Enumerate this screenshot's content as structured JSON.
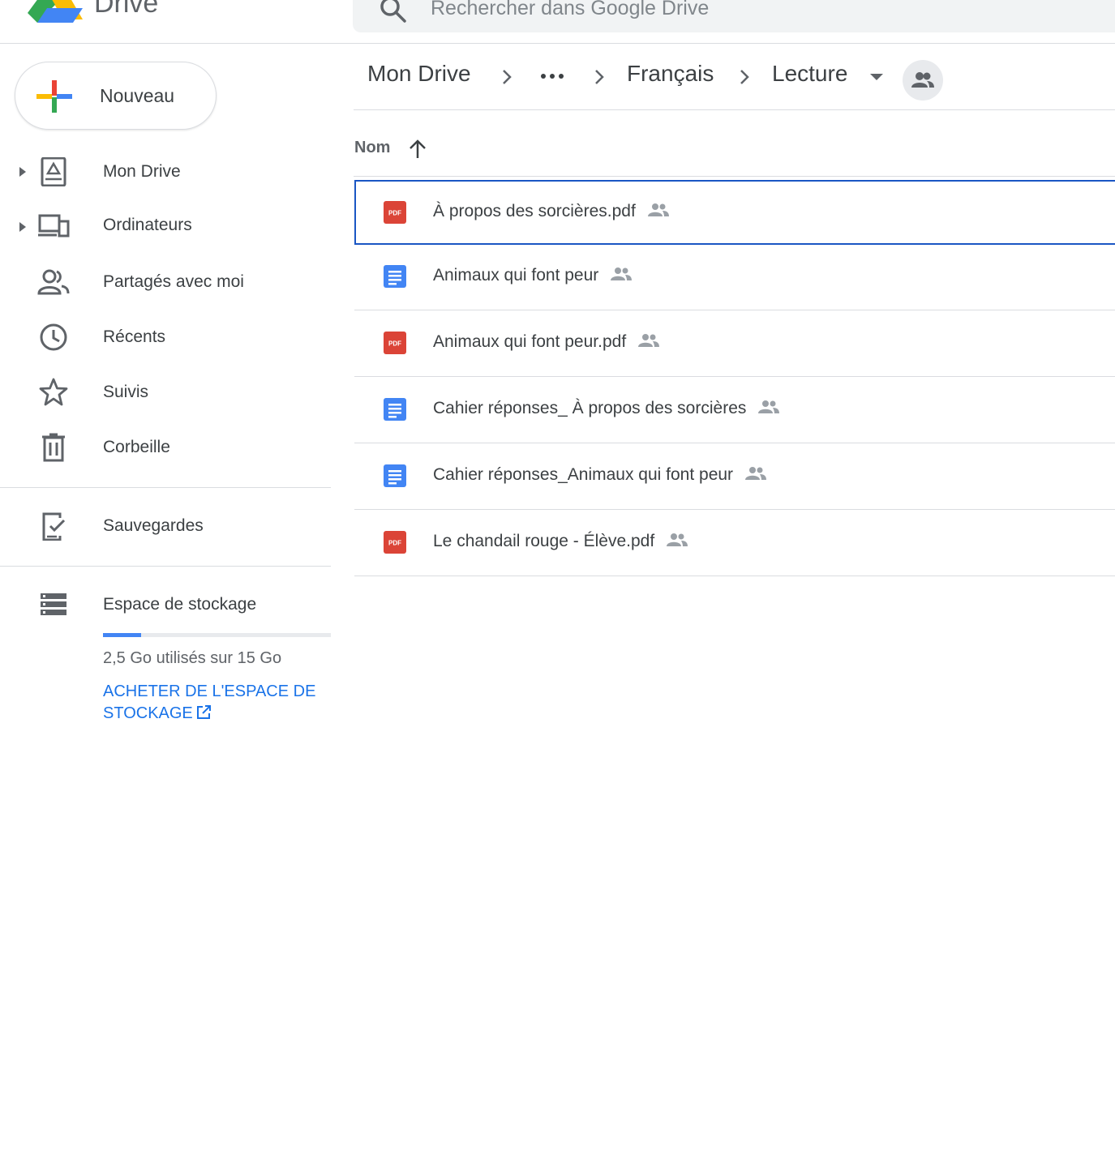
{
  "header": {
    "app_name": "Drive",
    "search_placeholder": "Rechercher dans Google Drive"
  },
  "sidebar": {
    "new_label": "Nouveau",
    "items": [
      {
        "label": "Mon Drive",
        "icon": "my-drive-icon"
      },
      {
        "label": "Ordinateurs",
        "icon": "computers-icon"
      },
      {
        "label": "Partagés avec moi",
        "icon": "people-icon"
      },
      {
        "label": "Récents",
        "icon": "clock-icon"
      },
      {
        "label": "Suivis",
        "icon": "star-icon"
      },
      {
        "label": "Corbeille",
        "icon": "trash-icon"
      },
      {
        "label": "Sauvegardes",
        "icon": "backup-icon"
      },
      {
        "label": "Espace de stockage",
        "icon": "storage-icon"
      }
    ],
    "storage": {
      "used_fraction": 0.1667,
      "text": "2,5 Go utilisés sur 15 Go",
      "buy_label": "ACHETER DE L'ESPACE DE STOCKAGE"
    }
  },
  "breadcrumb": {
    "items": [
      "Mon Drive",
      "Français",
      "Lecture"
    ],
    "more": "more-horiz-icon"
  },
  "list": {
    "column_name": "Nom",
    "sort": "ascending",
    "files": [
      {
        "name": "À propos des sorcières.pdf",
        "type": "pdf",
        "shared": true,
        "selected": true
      },
      {
        "name": "Animaux qui font peur",
        "type": "doc",
        "shared": true
      },
      {
        "name": "Animaux qui font peur.pdf",
        "type": "pdf",
        "shared": true
      },
      {
        "name": "Cahier réponses_ À propos des sorcières",
        "type": "doc",
        "shared": true
      },
      {
        "name": "Cahier réponses_Animaux qui font peur",
        "type": "doc",
        "shared": true
      },
      {
        "name": "Le chandail rouge - Élève.pdf",
        "type": "pdf",
        "shared": true
      }
    ]
  },
  "colors": {
    "accent": "#1a73e8",
    "pdf_red": "#db4437",
    "doc_blue": "#4285f4",
    "selected_border": "#1a56c4"
  }
}
